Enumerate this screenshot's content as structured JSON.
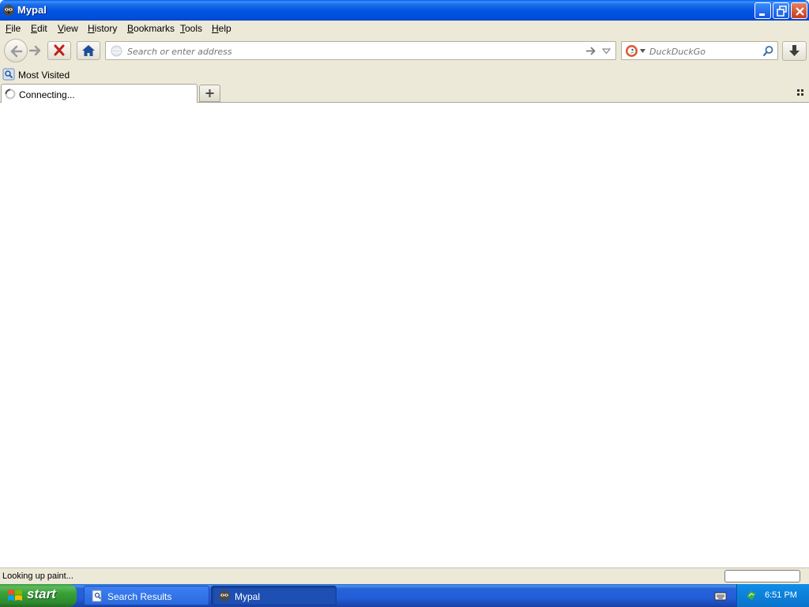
{
  "window": {
    "title": "Mypal",
    "app_icon": "raccoon-icon"
  },
  "menu": {
    "items": [
      {
        "label": "File",
        "underline": "F",
        "rest": "ile"
      },
      {
        "label": "Edit",
        "underline": "E",
        "rest": "dit"
      },
      {
        "label": "View",
        "underline": "V",
        "rest": "iew"
      },
      {
        "label": "History",
        "underline": "H",
        "rest": "istory"
      },
      {
        "label": "Bookmarks",
        "underline": "B",
        "rest": "ookmarks"
      },
      {
        "label": "Tools",
        "underline": "T",
        "rest": "ools"
      },
      {
        "label": "Help",
        "underline": "H",
        "rest": "elp"
      }
    ]
  },
  "navbar": {
    "url_placeholder": "Search or enter address",
    "url_value": "",
    "search_placeholder": "DuckDuckGo",
    "search_engine_icon": "duckduckgo-icon"
  },
  "bookmarks": {
    "items": [
      {
        "label": "Most Visited",
        "icon": "most-visited-icon"
      }
    ]
  },
  "tabs": [
    {
      "label": "Connecting...",
      "loading": true
    }
  ],
  "status": {
    "text": "Looking up paint..."
  },
  "taskbar": {
    "start_label": "start",
    "tasks": [
      {
        "label": "Search Results",
        "active": false,
        "icon": "search-results-icon"
      },
      {
        "label": "Mypal",
        "active": true,
        "icon": "raccoon-icon"
      }
    ],
    "clock": "6:51 PM"
  },
  "colors": {
    "titlebar": "#0053e1",
    "chrome": "#ece9d8",
    "taskbar": "#245edb",
    "start": "#37a237",
    "tray": "#0f8ee8",
    "stop_x": "#c0201a"
  }
}
